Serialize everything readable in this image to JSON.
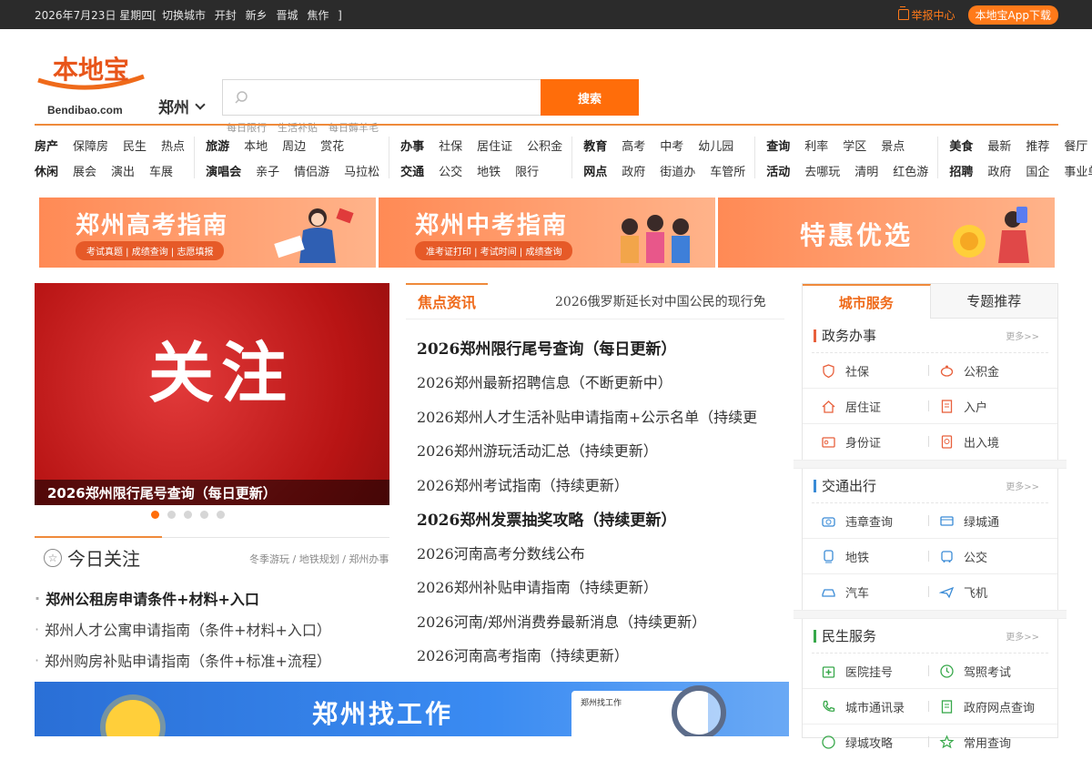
{
  "topbar": {
    "date": "2026年7月23日 星期四[",
    "switch_city": "切换城市",
    "cities": [
      "开封",
      "新乡",
      "晋城",
      "焦作"
    ],
    "bracket_close": "]",
    "report": "举报中心",
    "app_download": "本地宝App下载"
  },
  "brand": {
    "logo_cn": "本地宝",
    "logo_en": "Bendibao.com",
    "city": "郑州"
  },
  "search": {
    "placeholder": "",
    "button": "搜索",
    "hot": [
      "每日限行",
      "生活补贴",
      "每日薅羊毛"
    ]
  },
  "nav": [
    {
      "rows": [
        {
          "cat": "房产",
          "links": [
            "保障房",
            "民生",
            "热点"
          ]
        },
        {
          "cat": "休闲",
          "links": [
            "展会",
            "演出",
            "车展"
          ]
        }
      ]
    },
    {
      "rows": [
        {
          "cat": "旅游",
          "links": [
            "本地",
            "周边",
            "赏花"
          ]
        },
        {
          "cat": "演唱会",
          "links": [
            "亲子",
            "情侣游",
            "马拉松"
          ]
        }
      ]
    },
    {
      "rows": [
        {
          "cat": "办事",
          "links": [
            "社保",
            "居住证",
            "公积金"
          ]
        },
        {
          "cat": "交通",
          "links": [
            "公交",
            "地铁",
            "限行"
          ]
        }
      ]
    },
    {
      "rows": [
        {
          "cat": "教育",
          "links": [
            "高考",
            "中考",
            "幼儿园"
          ]
        },
        {
          "cat": "网点",
          "links": [
            "政府",
            "街道办",
            "车管所"
          ]
        }
      ]
    },
    {
      "rows": [
        {
          "cat": "查询",
          "links": [
            "利率",
            "学区",
            "景点"
          ]
        },
        {
          "cat": "活动",
          "links": [
            "去哪玩",
            "清明",
            "红色游"
          ]
        }
      ]
    },
    {
      "rows": [
        {
          "cat": "美食",
          "links": [
            "最新",
            "推荐",
            "餐厅"
          ]
        },
        {
          "cat": "招聘",
          "links": [
            "政府",
            "国企",
            "事业单位"
          ]
        }
      ]
    }
  ],
  "banners": [
    {
      "title": "郑州高考指南",
      "sub": "考试真题 | 成绩查询 | 志愿填报"
    },
    {
      "title": "郑州中考指南",
      "sub": "准考证打印 | 考试时间 | 成绩查询"
    },
    {
      "title": "特惠优选",
      "sub": ""
    }
  ],
  "slider": {
    "image_text": "关注",
    "caption": "2026郑州限行尾号查询（每日更新）",
    "dot_count": 5,
    "active_dot": 0
  },
  "today": {
    "title": "今日关注",
    "tags": "冬季游玩 / 地铁规划 / 郑州办事",
    "items": [
      {
        "text": "郑州公租房申请条件+材料+入口",
        "bold": true
      },
      {
        "text": "郑州人才公寓申请指南（条件+材料+入口）",
        "bold": false
      },
      {
        "text": "郑州购房补贴申请指南（条件+标准+流程）",
        "bold": false
      }
    ]
  },
  "focus": {
    "tab": "焦点资讯",
    "marquee": "2026俄罗斯延长对中国公民的现行免",
    "news": [
      {
        "text": "2026郑州限行尾号查询（每日更新）",
        "bold": true
      },
      {
        "text": "2026郑州最新招聘信息（不断更新中）",
        "bold": false
      },
      {
        "text": "2026郑州人才生活补贴申请指南+公示名单（持续更",
        "bold": false
      },
      {
        "text": "2026郑州游玩活动汇总（持续更新）",
        "bold": false
      },
      {
        "text": "2026郑州考试指南（持续更新）",
        "bold": false
      },
      {
        "text": "2026郑州发票抽奖攻略（持续更新）",
        "bold": true
      },
      {
        "text": "2026河南高考分数线公布",
        "bold": false
      },
      {
        "text": "2026郑州补贴申请指南（持续更新）",
        "bold": false
      },
      {
        "text": "2026河南/郑州消费券最新消息（持续更新）",
        "bold": false
      },
      {
        "text": "2026河南高考指南（持续更新）",
        "bold": false
      }
    ]
  },
  "job_banner": {
    "title": "郑州找工作",
    "card": "郑州找工作"
  },
  "side": {
    "tabs": [
      "城市服务",
      "专题推荐"
    ],
    "more": "更多>>",
    "sections": [
      {
        "name": "政务办事",
        "color": "#e8603c",
        "items": [
          {
            "label": "社保",
            "icon": "shield-icon"
          },
          {
            "label": "公积金",
            "icon": "piggy-bank-icon"
          },
          {
            "label": "居住证",
            "icon": "home-icon"
          },
          {
            "label": "入户",
            "icon": "document-icon"
          },
          {
            "label": "身份证",
            "icon": "id-card-icon"
          },
          {
            "label": "出入境",
            "icon": "passport-icon"
          }
        ]
      },
      {
        "name": "交通出行",
        "color": "#3a8bd6",
        "items": [
          {
            "label": "违章查询",
            "icon": "camera-icon"
          },
          {
            "label": "绿城通",
            "icon": "card-icon"
          },
          {
            "label": "地铁",
            "icon": "subway-icon"
          },
          {
            "label": "公交",
            "icon": "bus-icon"
          },
          {
            "label": "汽车",
            "icon": "car-icon"
          },
          {
            "label": "飞机",
            "icon": "plane-icon"
          }
        ]
      },
      {
        "name": "民生服务",
        "color": "#37a84a",
        "items": [
          {
            "label": "医院挂号",
            "icon": "hospital-icon"
          },
          {
            "label": "驾照考试",
            "icon": "clock-icon"
          },
          {
            "label": "城市通讯录",
            "icon": "phone-icon"
          },
          {
            "label": "政府网点查询",
            "icon": "list-icon"
          },
          {
            "label": "绿城攻略",
            "icon": "compass-icon"
          },
          {
            "label": "常用查询",
            "icon": "star-icon"
          }
        ]
      }
    ]
  },
  "colors": {
    "accent": "#ff6d0a",
    "topbar": "#2b2b2b"
  }
}
